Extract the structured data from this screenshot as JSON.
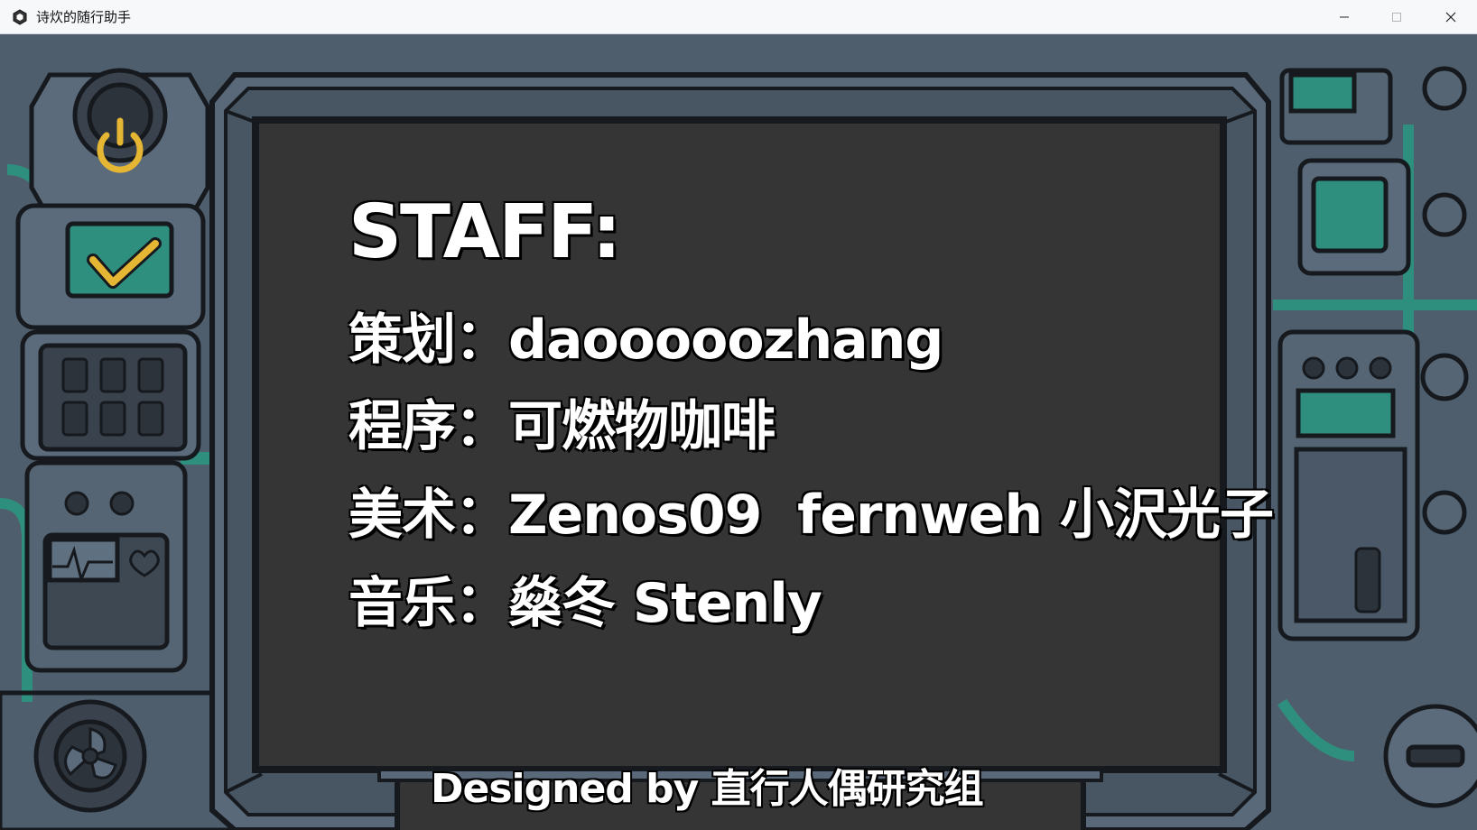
{
  "window": {
    "title": "诗炊的随行助手",
    "icon": "hexagon-app-icon",
    "controls": [
      "minimize-icon",
      "maximize-icon",
      "close-icon"
    ]
  },
  "credits": {
    "heading": "STAFF:",
    "lines": [
      {
        "role": "策划：",
        "names": "daooooozhang"
      },
      {
        "role": "程序：",
        "names": "可燃物咖啡"
      },
      {
        "role": "美术：",
        "names": "Zenos09  fernweh 小沢光子"
      },
      {
        "role": "音乐：",
        "names": "燊冬 Stenly"
      }
    ],
    "footer": "Designed by 直行人偶研究组"
  },
  "colors": {
    "screen": "#353535",
    "machine_body": "#566574",
    "machine_dark": "#2c333b",
    "teal": "#2f8f7f",
    "accent_yellow": "#e5b534",
    "outline": "#161a1e"
  },
  "icons": [
    "power-icon",
    "checkmark-icon",
    "heart-icon",
    "fan-icon"
  ]
}
